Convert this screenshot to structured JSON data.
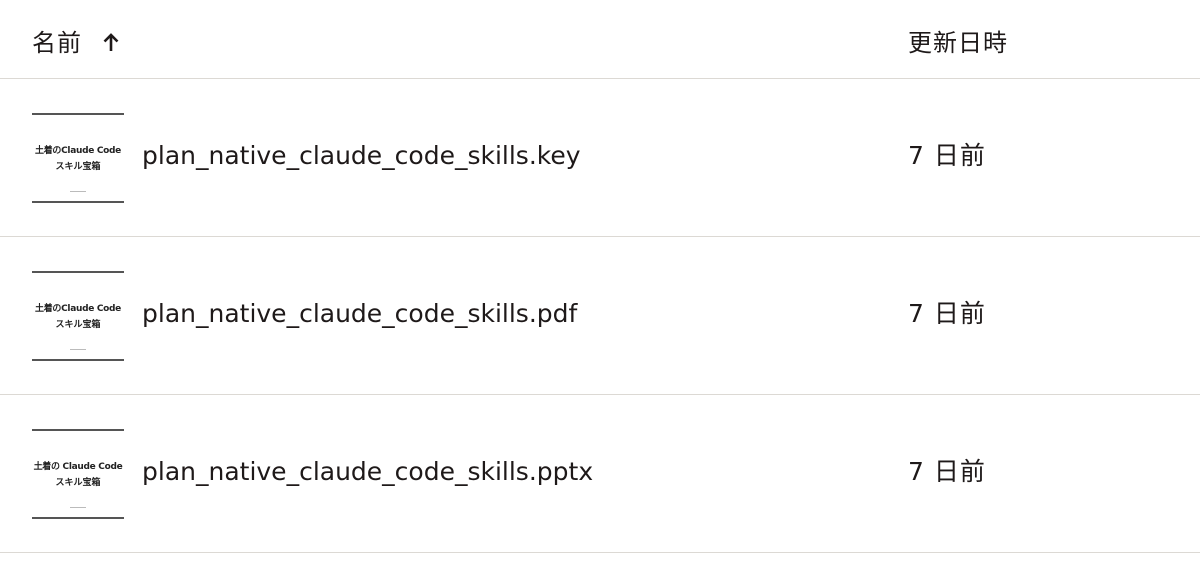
{
  "header": {
    "name_label": "名前",
    "sort_icon": "arrow-up-icon",
    "modified_label": "更新日時"
  },
  "files": [
    {
      "name": "plan_native_claude_code_skills.key",
      "modified": "7 日前",
      "thumbnail": {
        "line1": "土着のClaude Code",
        "line2": "スキル宝箱"
      }
    },
    {
      "name": "plan_native_claude_code_skills.pdf",
      "modified": "7 日前",
      "thumbnail": {
        "line1": "土着のClaude Code",
        "line2": "スキル宝箱"
      }
    },
    {
      "name": "plan_native_claude_code_skills.pptx",
      "modified": "7 日前",
      "thumbnail": {
        "line1": "土着の Claude Code",
        "line2": "スキル宝箱"
      }
    }
  ]
}
